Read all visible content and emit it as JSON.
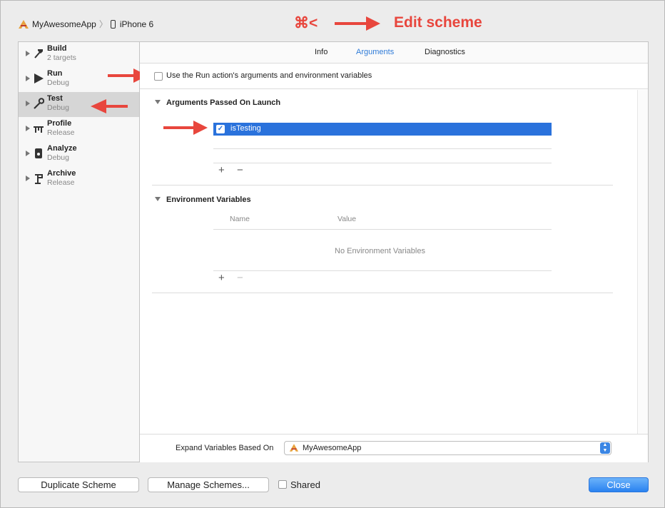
{
  "breadcrumb": {
    "project": "MyAwesomeApp",
    "device": "iPhone 6"
  },
  "annotations": {
    "shortcut": "⌘<",
    "edit_scheme": "Edit scheme",
    "color": "#e8463d"
  },
  "sidebar": {
    "items": [
      {
        "name": "Build",
        "sub": "2 targets",
        "icon": "hammer-icon"
      },
      {
        "name": "Run",
        "sub": "Debug",
        "icon": "play-icon"
      },
      {
        "name": "Test",
        "sub": "Debug",
        "icon": "wrench-icon",
        "selected": true
      },
      {
        "name": "Profile",
        "sub": "Release",
        "icon": "instruments-icon"
      },
      {
        "name": "Analyze",
        "sub": "Debug",
        "icon": "analyze-icon"
      },
      {
        "name": "Archive",
        "sub": "Release",
        "icon": "archive-icon"
      }
    ]
  },
  "tabs": [
    {
      "label": "Info",
      "active": false
    },
    {
      "label": "Arguments",
      "active": true
    },
    {
      "label": "Diagnostics",
      "active": false
    }
  ],
  "use_run_action_label": "Use the Run action's arguments and environment variables",
  "arguments_section": {
    "title": "Arguments Passed On Launch",
    "items": [
      {
        "value": "isTesting",
        "checked": true
      }
    ]
  },
  "environment_section": {
    "title": "Environment Variables",
    "col_name": "Name",
    "col_value": "Value",
    "empty_text": "No Environment Variables"
  },
  "controls": {
    "add": "+",
    "remove": "−"
  },
  "expand_variables": {
    "label": "Expand Variables Based On",
    "value": "MyAwesomeApp"
  },
  "buttons": {
    "duplicate": "Duplicate Scheme",
    "manage": "Manage Schemes...",
    "shared": "Shared",
    "close": "Close"
  },
  "accent_color": "#2a72dc"
}
